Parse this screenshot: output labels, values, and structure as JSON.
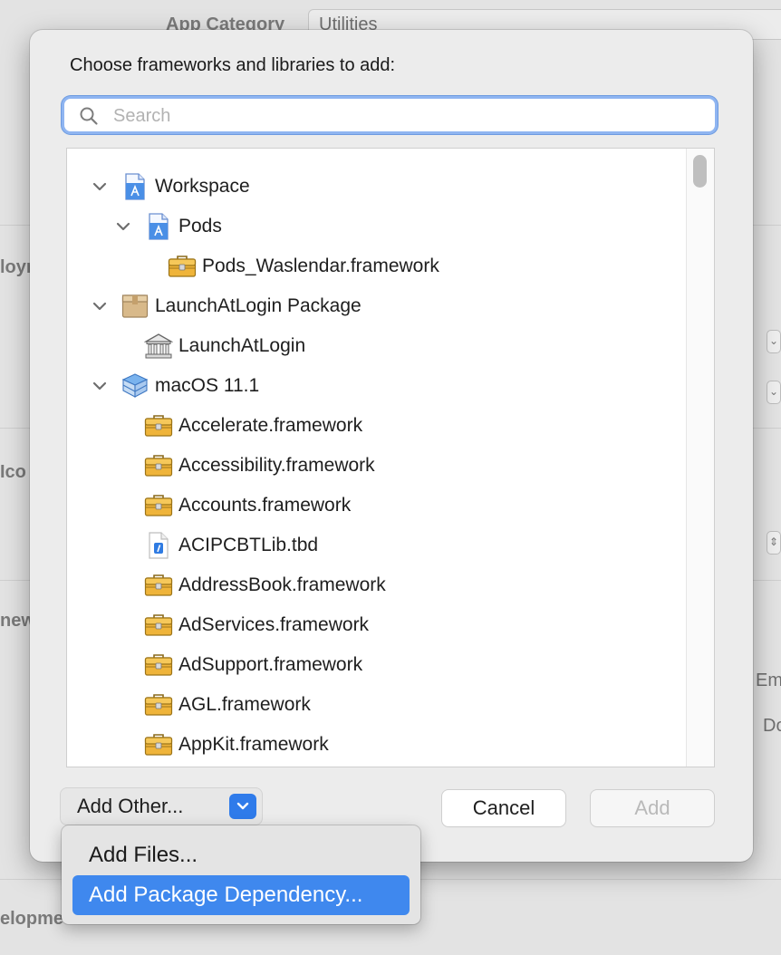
{
  "background": {
    "app_category_label": "App Category",
    "app_category_value": "Utilities",
    "fragments": [
      "loym",
      "Ico",
      "new",
      "elopme",
      "Em",
      "Do"
    ]
  },
  "dialog": {
    "prompt": "Choose frameworks and libraries to add:",
    "search": {
      "placeholder": "Search",
      "value": ""
    },
    "tree": [
      {
        "label": "Workspace",
        "icon": "workspace-icon",
        "expandable": true,
        "level": 0
      },
      {
        "label": "Pods",
        "icon": "project-icon",
        "expandable": true,
        "level": 1
      },
      {
        "label": "Pods_Waslendar.framework",
        "icon": "framework-toolbox-icon",
        "expandable": false,
        "level": 2
      },
      {
        "label": "LaunchAtLogin Package",
        "icon": "package-box-icon",
        "expandable": true,
        "level": 0
      },
      {
        "label": "LaunchAtLogin",
        "icon": "library-building-icon",
        "expandable": false,
        "level": 1
      },
      {
        "label": "macOS 11.1",
        "icon": "sdk-icon",
        "expandable": true,
        "level": 0
      },
      {
        "label": "Accelerate.framework",
        "icon": "framework-toolbox-icon",
        "expandable": false,
        "level": 1
      },
      {
        "label": "Accessibility.framework",
        "icon": "framework-toolbox-icon",
        "expandable": false,
        "level": 1
      },
      {
        "label": "Accounts.framework",
        "icon": "framework-toolbox-icon",
        "expandable": false,
        "level": 1
      },
      {
        "label": "ACIPCBTLib.tbd",
        "icon": "tbd-file-icon",
        "expandable": false,
        "level": 1
      },
      {
        "label": "AddressBook.framework",
        "icon": "framework-toolbox-icon",
        "expandable": false,
        "level": 1
      },
      {
        "label": "AdServices.framework",
        "icon": "framework-toolbox-icon",
        "expandable": false,
        "level": 1
      },
      {
        "label": "AdSupport.framework",
        "icon": "framework-toolbox-icon",
        "expandable": false,
        "level": 1
      },
      {
        "label": "AGL.framework",
        "icon": "framework-toolbox-icon",
        "expandable": false,
        "level": 1
      },
      {
        "label": "AppKit.framework",
        "icon": "framework-toolbox-icon",
        "expandable": false,
        "level": 1
      }
    ],
    "buttons": {
      "add_other": "Add Other...",
      "cancel": "Cancel",
      "add": "Add"
    },
    "menu": {
      "items": [
        "Add Files...",
        "Add Package Dependency..."
      ],
      "highlighted_index": 1
    },
    "colors": {
      "accent": "#3f88ee",
      "focus_ring": "#8fb5f1",
      "toolbox": "#e6a52b"
    }
  }
}
